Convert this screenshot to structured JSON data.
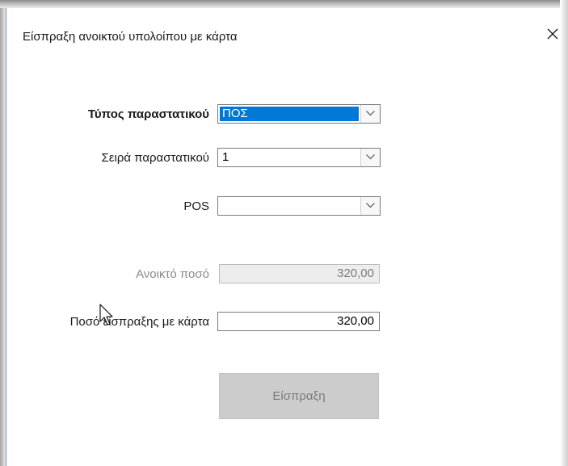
{
  "window": {
    "title": "Είσπραξη ανοικτού υπολοίπου με κάρτα"
  },
  "form": {
    "document_type": {
      "label": "Τύπος παραστατικού",
      "value": "ΠΟΣ"
    },
    "document_series": {
      "label": "Σειρά παραστατικού",
      "value": "1"
    },
    "pos": {
      "label": "POS",
      "value": ""
    },
    "open_amount": {
      "label": "Ανοικτό ποσό",
      "value": "320,00"
    },
    "card_amount": {
      "label": "Ποσό είσπραξης με κάρτα",
      "value": "320,00"
    },
    "submit_label": "Είσπραξη"
  },
  "icons": {
    "close": "close-icon",
    "dropdown": "chevron-down-icon",
    "cursor": "mouse-cursor-icon"
  },
  "colors": {
    "selection": "#0078d7",
    "disabled_button": "#cccccc",
    "readonly_field": "#ededed"
  }
}
